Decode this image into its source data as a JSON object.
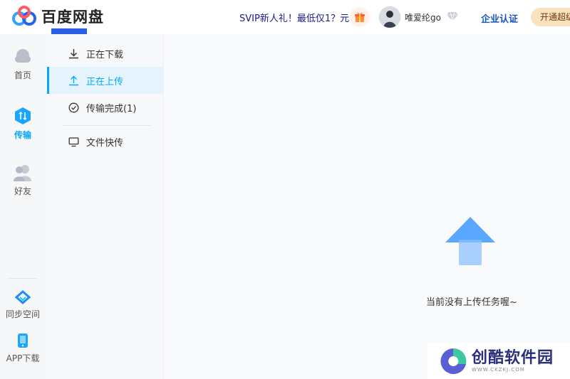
{
  "header": {
    "brand": "百度网盘",
    "promo": "SVIP新人礼！最低仅1？元",
    "username": "唯爱纶go",
    "enterprise_label": "企业认证",
    "open_button_label": "开通超级"
  },
  "rail": {
    "items": [
      {
        "label": "首页",
        "icon": "cloud-icon"
      },
      {
        "label": "传输",
        "icon": "transfer-icon",
        "active": true
      },
      {
        "label": "好友",
        "icon": "friends-icon"
      },
      {
        "label": "同步空间",
        "icon": "sync-icon"
      },
      {
        "label": "APP下载",
        "icon": "phone-icon"
      }
    ]
  },
  "submenu": {
    "items": [
      {
        "label": "正在下载",
        "icon": "download-icon"
      },
      {
        "label": "正在上传",
        "icon": "upload-icon",
        "active": true
      },
      {
        "label": "传输完成(1)",
        "icon": "check-circle-icon"
      },
      {
        "label": "文件快传",
        "icon": "monitor-icon"
      }
    ]
  },
  "main": {
    "empty_text": "当前没有上传任务喔~"
  },
  "watermark": {
    "title": "创酷软件园",
    "url": "WWW.CKZKJ.COM"
  },
  "colors": {
    "accent": "#06a7ff",
    "active_bg": "#e5f3fc",
    "brand_bar": "#2c5ee8",
    "vip_button": "#fbe2bf"
  }
}
